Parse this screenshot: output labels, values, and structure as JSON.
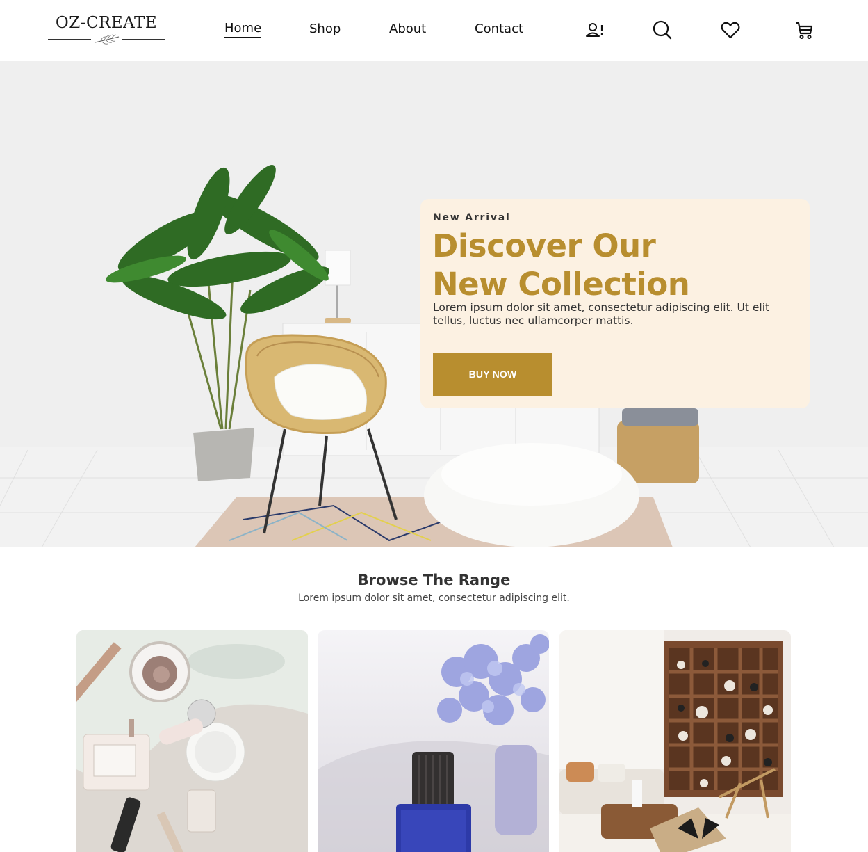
{
  "brand": {
    "logo_text": "OZ-CREATE"
  },
  "nav": {
    "items": [
      {
        "label": "Home",
        "active": true
      },
      {
        "label": "Shop",
        "active": false
      },
      {
        "label": "About",
        "active": false
      },
      {
        "label": "Contact",
        "active": false
      }
    ]
  },
  "header_icons": [
    "account-alert-icon",
    "search-icon",
    "heart-icon",
    "cart-icon"
  ],
  "hero": {
    "eyebrow": "New Arrival",
    "title_line1": "Discover Our",
    "title_line2": "New Collection",
    "description": "Lorem ipsum dolor sit amet, consectetur adipiscing elit. Ut elit tellus, luctus nec ullamcorper mattis.",
    "button_label": "BUY NOW"
  },
  "browse": {
    "title": "Browse The Range",
    "subtitle": "Lorem ipsum dolor sit amet, consectetur adipiscing elit.",
    "cards": [
      "cosmetics-photo",
      "perfume-photo",
      "living-room-photo"
    ]
  },
  "colors": {
    "accent": "#b88e2f",
    "card_bg": "#fcf1e2",
    "text_dark": "#333333"
  }
}
